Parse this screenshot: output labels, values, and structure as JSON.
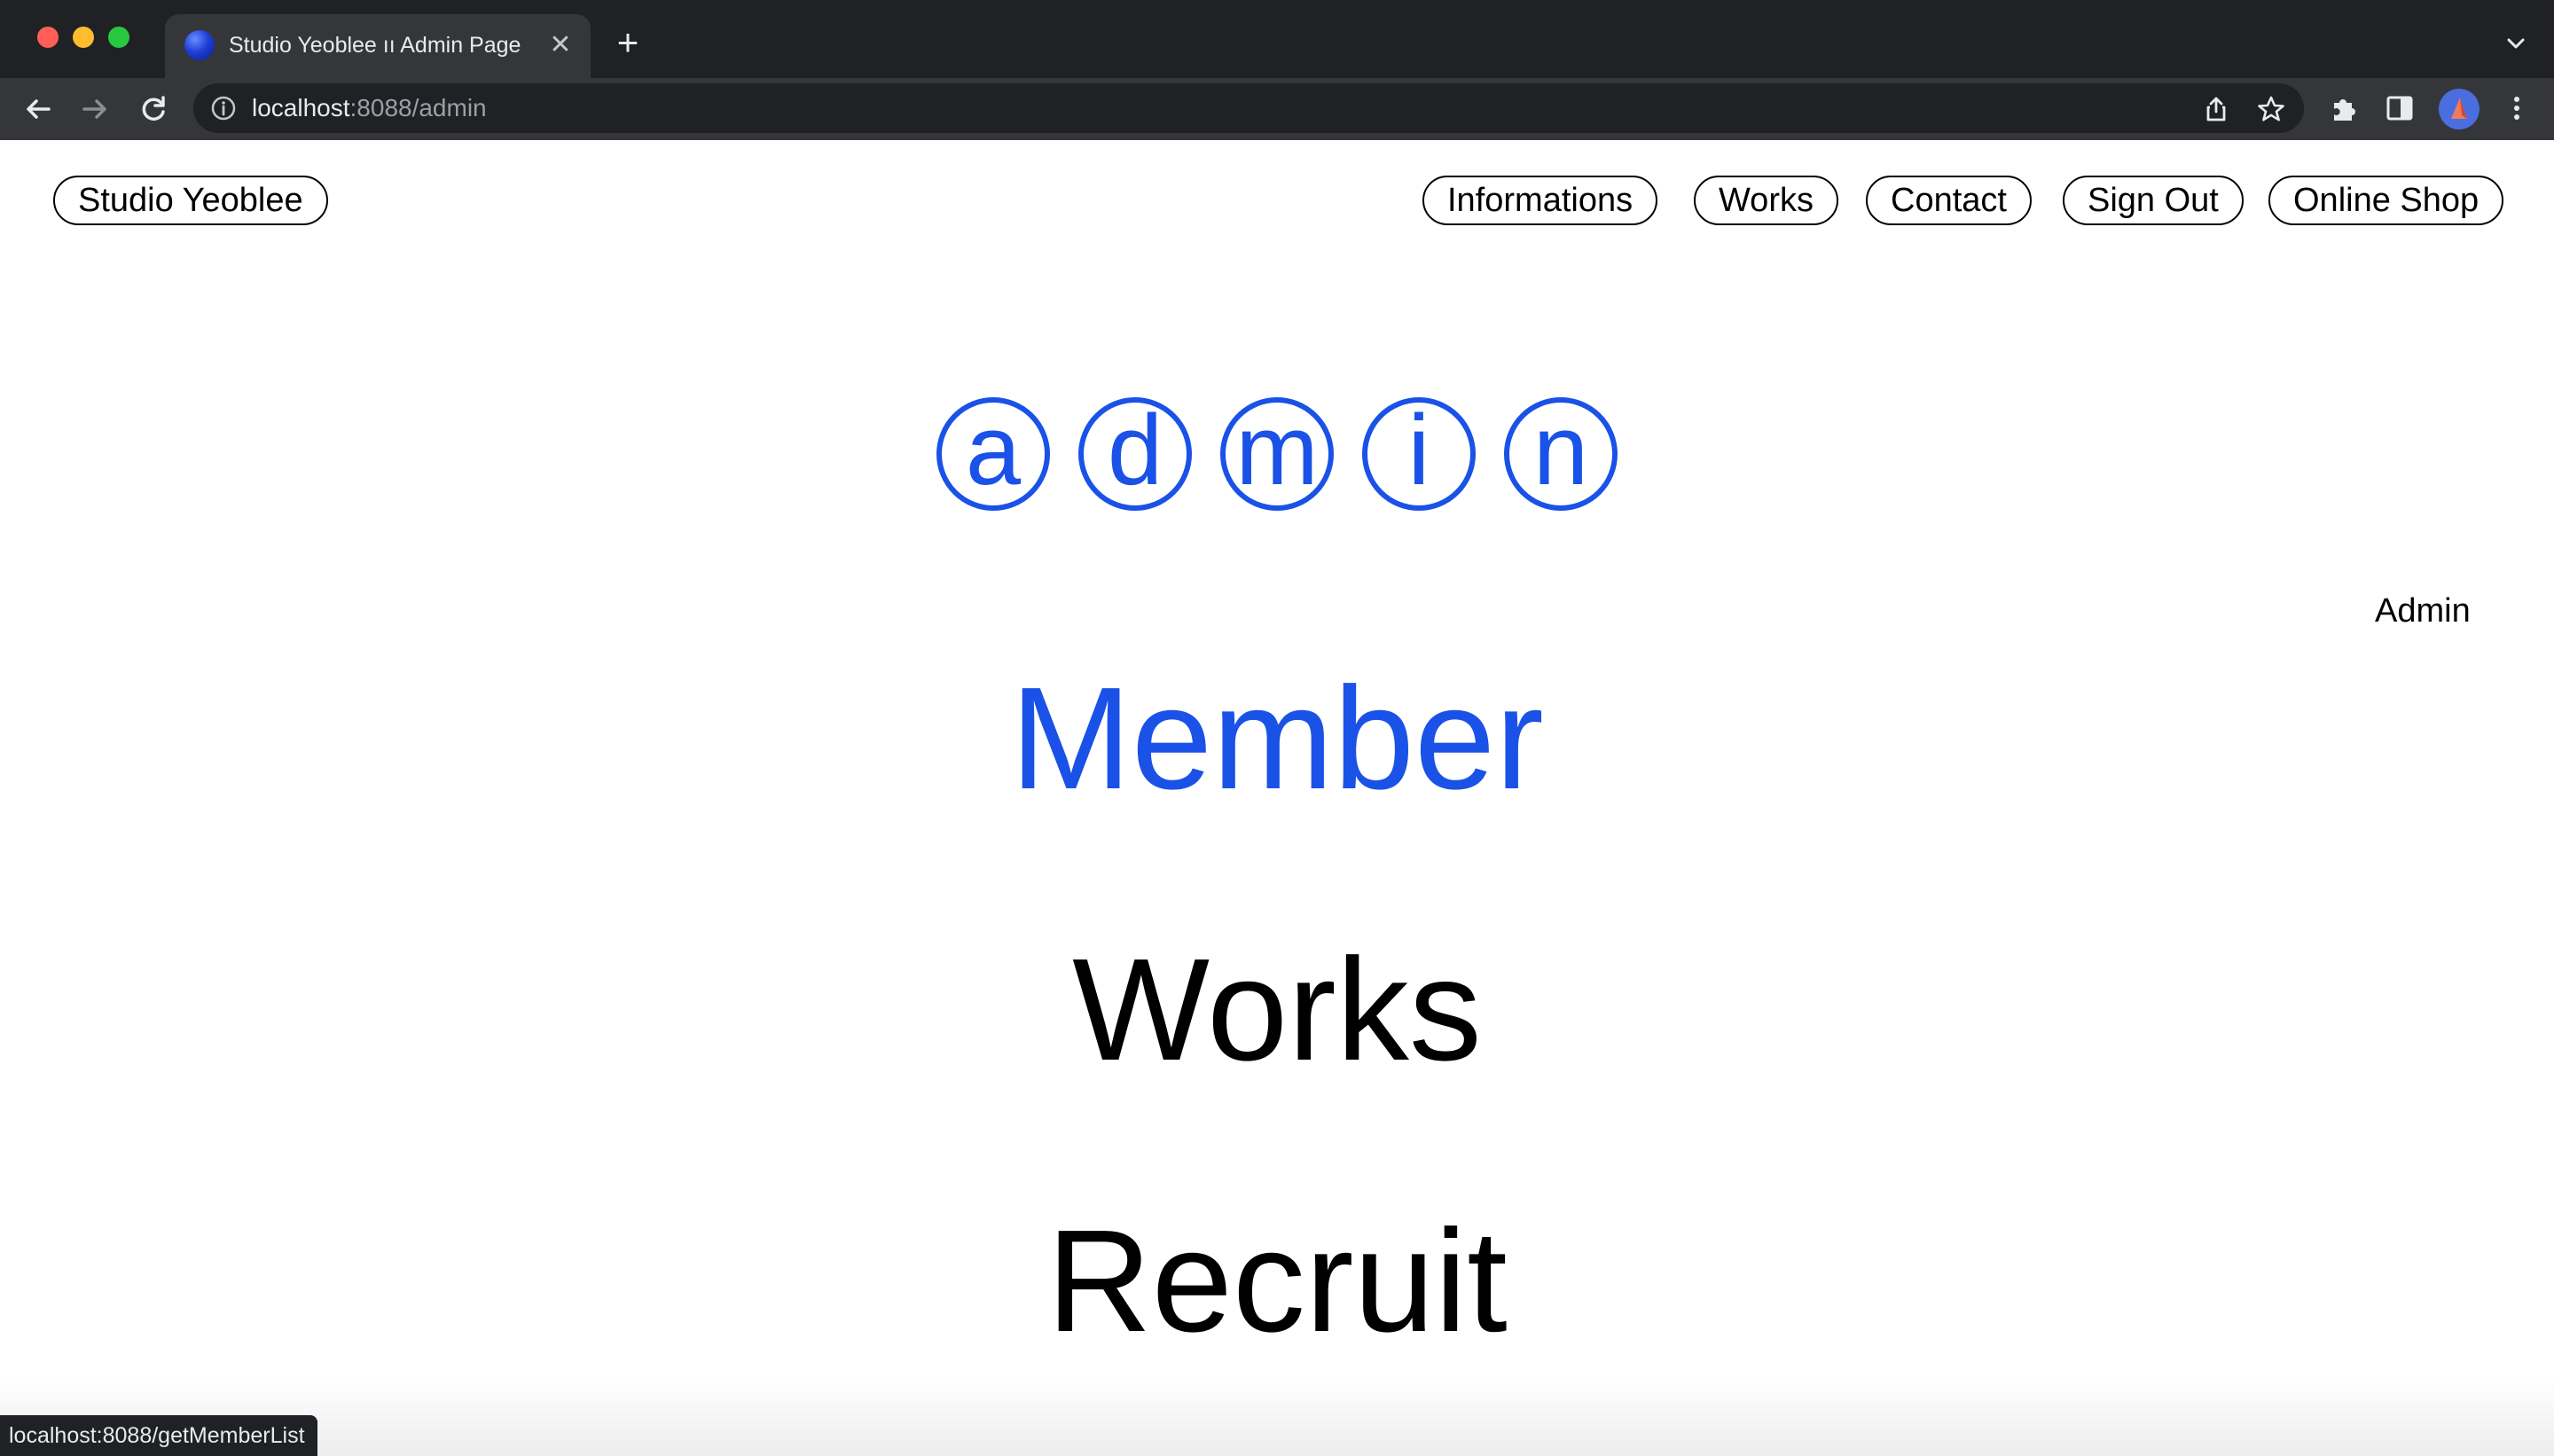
{
  "browser": {
    "tab_title": "Studio Yeoblee ıı Admin Page",
    "url_host": "localhost",
    "url_path": ":8088/admin",
    "status_url": "localhost:8088/getMemberList"
  },
  "header": {
    "brand": "Studio Yeoblee",
    "nav": [
      {
        "label": "Informations"
      },
      {
        "label": "Works"
      },
      {
        "label": "Contact"
      },
      {
        "label": "Sign Out"
      },
      {
        "label": "Online Shop"
      }
    ]
  },
  "hero": {
    "circled_letters": [
      "a",
      "d",
      "m",
      "i",
      "n"
    ],
    "accent_color": "#1a52e8"
  },
  "sidebar": {
    "role_label": "Admin"
  },
  "menu": {
    "items": [
      {
        "label": "Member",
        "active": true
      },
      {
        "label": "Works",
        "active": false
      },
      {
        "label": "Recruit",
        "active": false
      }
    ]
  }
}
